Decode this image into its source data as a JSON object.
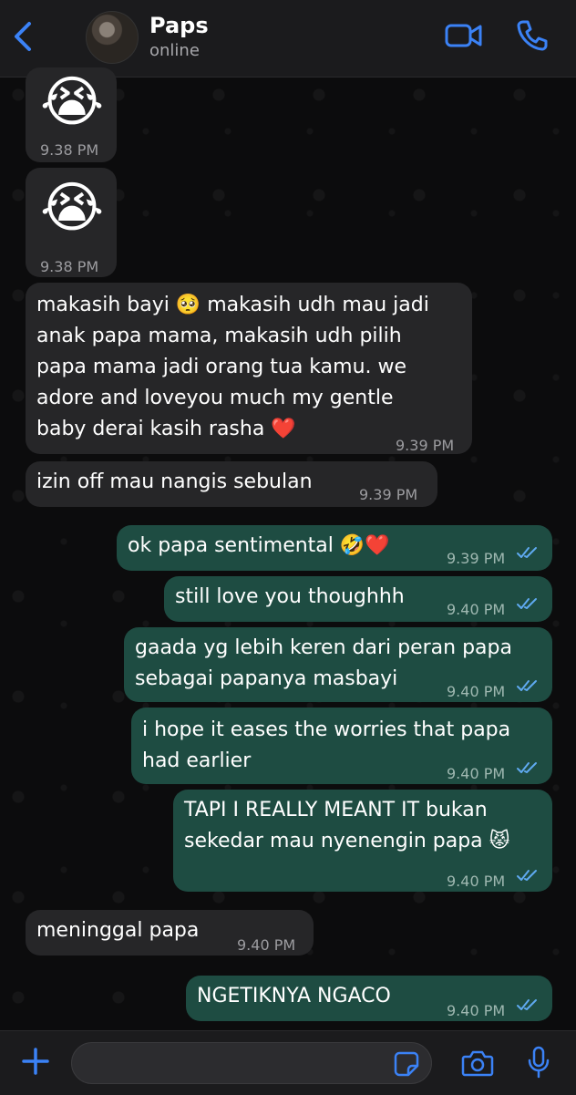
{
  "header": {
    "contact_name": "Paps",
    "status": "online"
  },
  "messages": [
    {
      "dir": "in",
      "text": "😭",
      "time": "9.38 PM"
    },
    {
      "dir": "in",
      "text": "😭",
      "time": "9.38 PM"
    },
    {
      "dir": "in",
      "text": "makasih bayi 🥺 makasih udh mau jadi\nanak papa mama, makasih udh pilih\npapa mama jadi orang tua kamu. we\nadore and loveyou much my gentle\nbaby derai kasih rasha ❤️",
      "time": "9.39 PM"
    },
    {
      "dir": "in",
      "text": "izin off mau nangis sebulan",
      "time": "9.39 PM"
    },
    {
      "dir": "out",
      "text": "ok papa sentimental 🤣❤️",
      "time": "9.39 PM"
    },
    {
      "dir": "out",
      "text": "still love you thoughhh",
      "time": "9.40 PM"
    },
    {
      "dir": "out",
      "text": "gaada yg lebih keren dari peran papa\nsebagai papanya masbayi",
      "time": "9.40 PM"
    },
    {
      "dir": "out",
      "text": "i hope it eases the worries that papa\nhad earlier",
      "time": "9.40 PM"
    },
    {
      "dir": "out",
      "text": "TAPI I REALLY MEANT IT bukan\nsekedar mau nyenengin papa 😾",
      "time": "9.40 PM"
    },
    {
      "dir": "in",
      "text": "meninggal papa",
      "time": "9.40 PM"
    },
    {
      "dir": "out",
      "text": "NGETIKNYA NGACO",
      "time": "9.40 PM"
    }
  ],
  "colors": {
    "accent_blue": "#3b82f6",
    "incoming_bubble": "#262628",
    "outgoing_bubble": "#1e4c42",
    "read_ticks": "#5fa9f0"
  },
  "icons": {
    "back": "chevron-left-icon",
    "video": "video-camera-icon",
    "call": "phone-icon",
    "attach": "plus-icon",
    "sticker": "sticker-icon",
    "camera": "camera-icon",
    "mic": "microphone-icon"
  }
}
